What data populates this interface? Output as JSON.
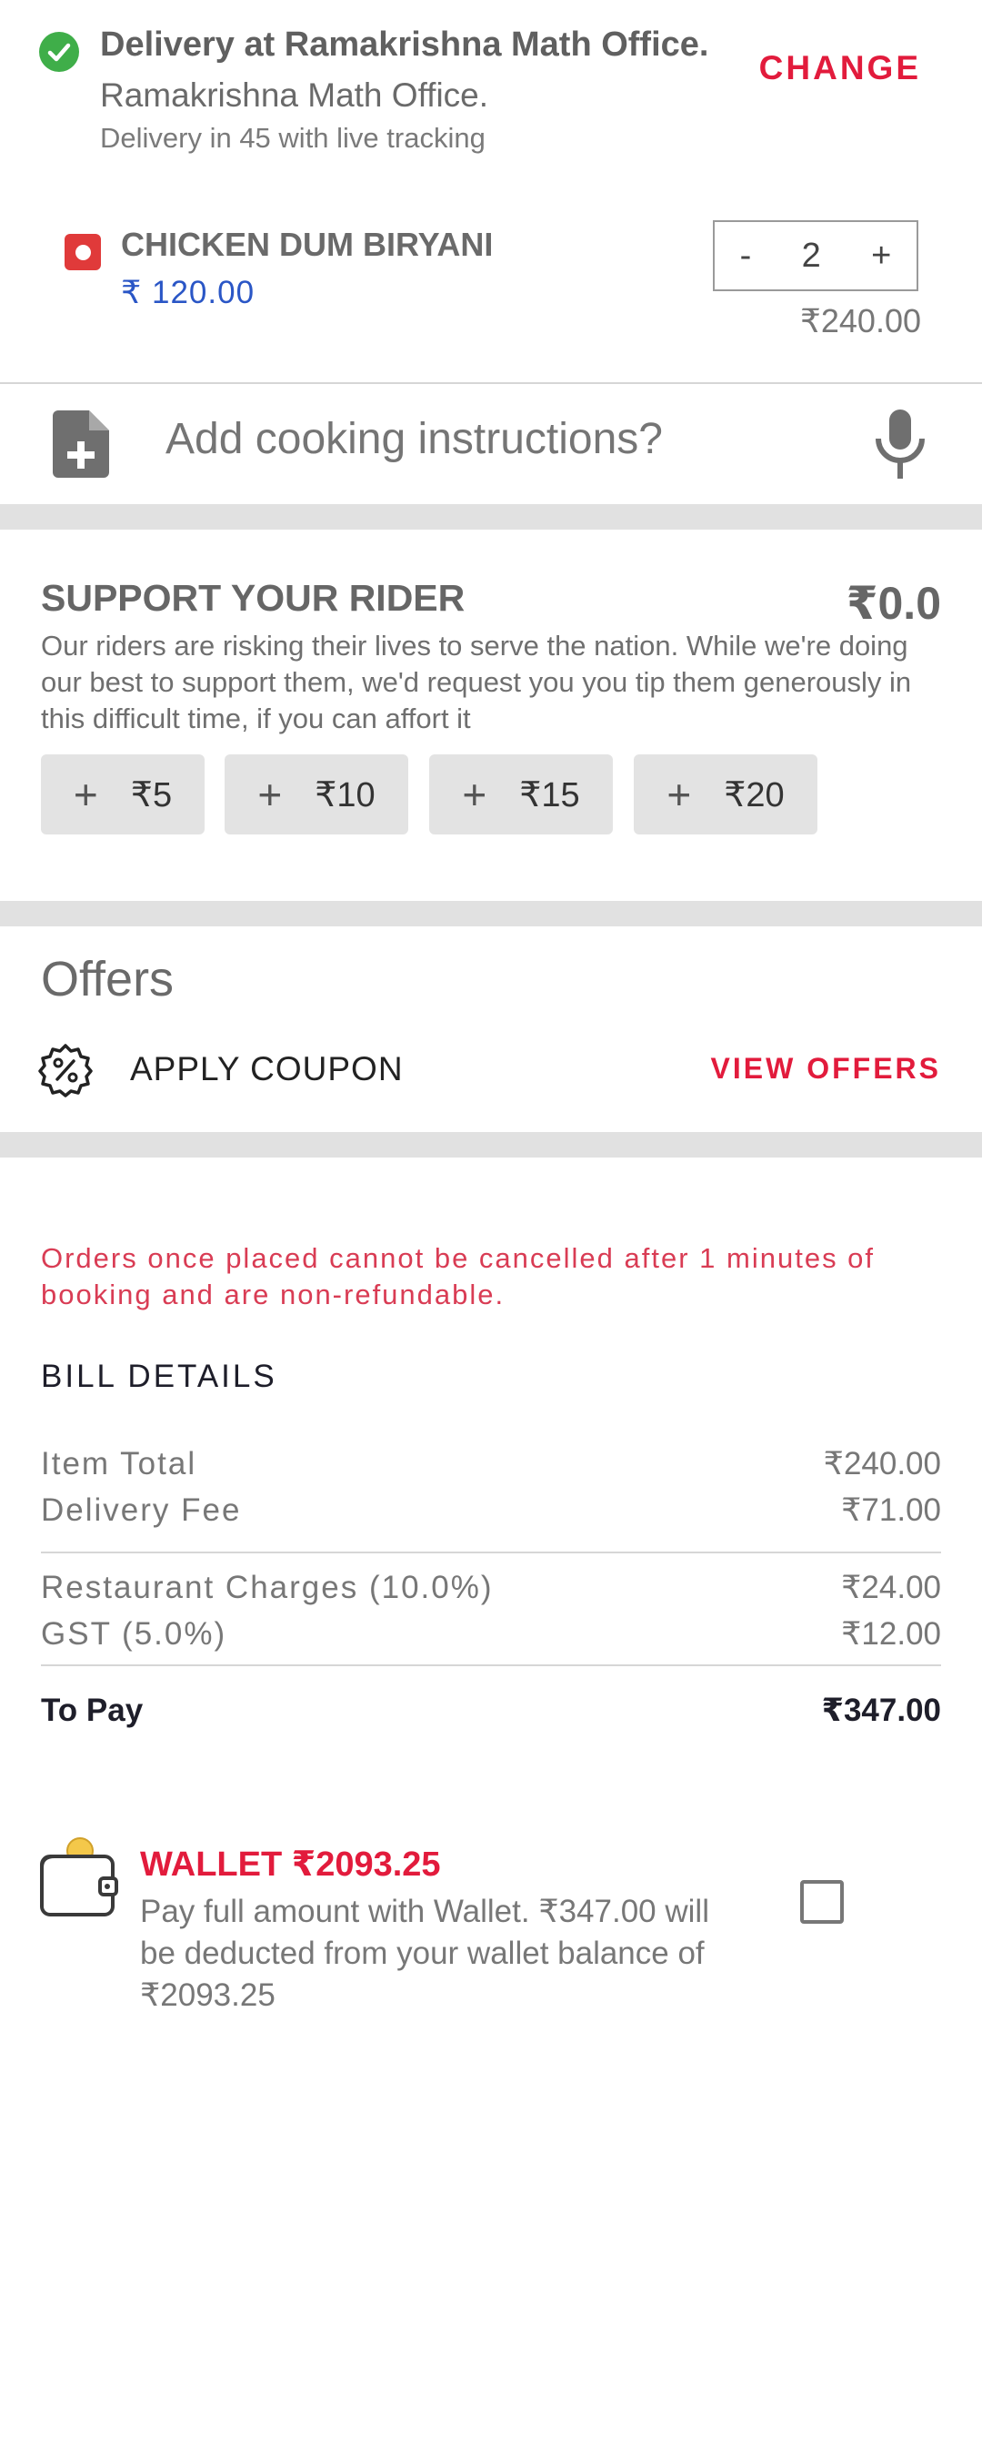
{
  "delivery": {
    "title": "Delivery at Ramakrishna Math Office.",
    "address": "Ramakrishna Math Office.",
    "eta": "Delivery in 45 with live tracking",
    "change_label": "CHANGE"
  },
  "item": {
    "name": "CHICKEN DUM BIRYANI",
    "unit_price": "₹ 120.00",
    "quantity": "2",
    "minus": "-",
    "plus": "+",
    "total": "₹240.00"
  },
  "cooking": {
    "placeholder": "Add cooking instructions?"
  },
  "rider": {
    "title": "SUPPORT YOUR RIDER",
    "amount": "₹0.0",
    "description": "Our riders are risking their lives to serve the nation. While we're doing our best to support them, we'd request you you tip them generously in this difficult time, if  you can affort it",
    "tips": [
      {
        "label": "₹5"
      },
      {
        "label": "₹10"
      },
      {
        "label": "₹15"
      },
      {
        "label": "₹20"
      }
    ],
    "tip_plus": "+"
  },
  "offers": {
    "title": "Offers",
    "apply_coupon": "APPLY COUPON",
    "view_offers": "VIEW OFFERS"
  },
  "bill": {
    "notice": "Orders once placed cannot be cancelled after 1 minutes of booking and are non-refundable.",
    "title": "BILL DETAILS",
    "rows": [
      {
        "label": "Item Total",
        "value": "₹240.00"
      },
      {
        "label": "Delivery Fee",
        "value": "₹71.00"
      },
      {
        "label": "Restaurant Charges  (10.0%)",
        "value": "₹24.00"
      },
      {
        "label": "GST  (5.0%)",
        "value": "₹12.00"
      }
    ],
    "to_pay_label": "To Pay",
    "to_pay_value": "₹347.00"
  },
  "wallet": {
    "title": "WALLET ₹2093.25",
    "description": "Pay full amount with Wallet. ₹347.00 will be deducted from your wallet balance of ₹2093.25",
    "checked": false
  },
  "colors": {
    "accent": "#e21b3c",
    "check_green": "#3fae49",
    "price_blue": "#2a56c6",
    "nonveg_red": "#e03a3a"
  },
  "icons": [
    "check-circle-icon",
    "non-veg-icon",
    "add-note-icon",
    "mic-icon",
    "plus-icon",
    "coupon-icon",
    "wallet-icon",
    "checkbox-icon"
  ]
}
